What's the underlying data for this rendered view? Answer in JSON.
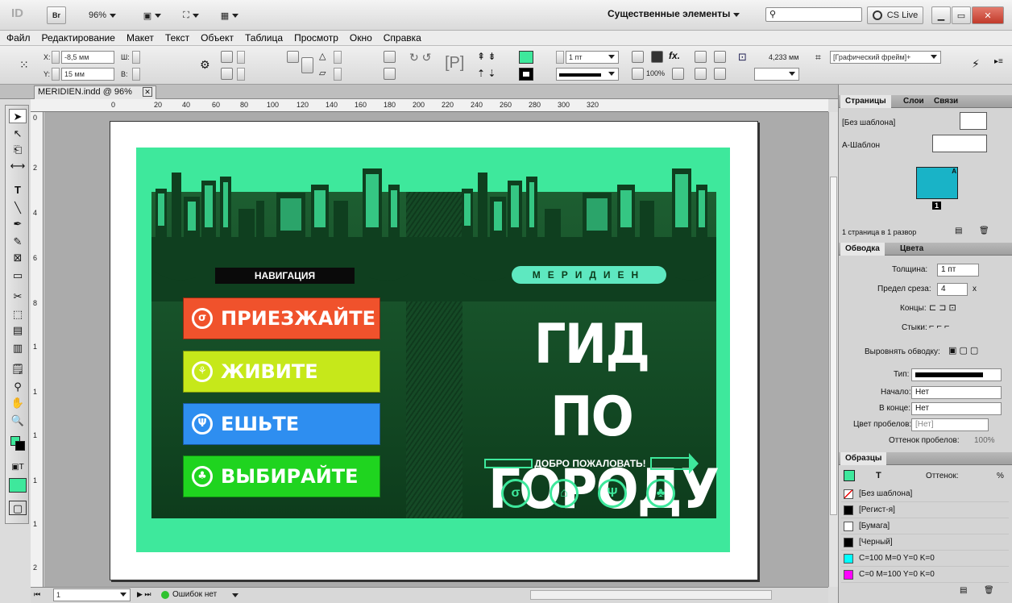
{
  "titlebar": {
    "zoom": "96%",
    "workspace": "Существенные элементы",
    "cslive": "CS Live",
    "app_glyph": "ID",
    "bridge": "Br"
  },
  "menu": [
    "Файл",
    "Редактирование",
    "Макет",
    "Текст",
    "Объект",
    "Таблица",
    "Просмотр",
    "Окно",
    "Справка"
  ],
  "control": {
    "x_label": "X:",
    "x_value": "-8,5 мм",
    "y_label": "Y:",
    "y_value": "15 мм",
    "w_label": "Ш:",
    "h_label": "В:",
    "stroke_weight": "1 пт",
    "zoom_pct": "100%",
    "dim_value": "4,233 мм",
    "frame_style": "[Графический фрейм]+"
  },
  "document": {
    "tab_title": "MERIDIEN.indd @ 96%",
    "ruler_h": [
      "0",
      "20",
      "40",
      "60",
      "80",
      "100",
      "120",
      "140",
      "160",
      "180",
      "200",
      "220",
      "240",
      "260",
      "280",
      "300",
      "320"
    ],
    "ruler_v": [
      "0",
      "2",
      "4",
      "6",
      "8",
      "1",
      "1",
      "1",
      "1",
      "1",
      "2",
      "2"
    ]
  },
  "poster": {
    "nav_label": "НАВИГАЦИЯ",
    "nav_items": [
      {
        "label": "ПРИЕЗЖАЙТЕ",
        "color": "#f0522c",
        "icon": "σ"
      },
      {
        "label": "ЖИВИТЕ",
        "color": "#c6e81a",
        "icon": "⚘"
      },
      {
        "label": "ЕШЬТЕ",
        "color": "#2e8ef0",
        "icon": "Ψ"
      },
      {
        "label": "ВЫБИРАЙТЕ",
        "color": "#1fd41f",
        "icon": "♣"
      }
    ],
    "brand": "МЕРИДИЕН",
    "title_line1": "ГИД ПО",
    "title_line2": "ГОРОДУ",
    "welcome": "ДОБРО ПОЖАЛОВАТЬ!",
    "bottom_icons": [
      "σ",
      "⌂",
      "Ψ",
      "♣"
    ]
  },
  "panels": {
    "pages": {
      "tabs": [
        "Страницы",
        "Слои",
        "Связи"
      ],
      "none_master": "[Без шаблона]",
      "a_master": "A-Шаблон",
      "page_number": "1",
      "page_letter": "A",
      "footer": "1 страница в 1 развор"
    },
    "stroke": {
      "tabs": [
        "Обводка",
        "Цвета"
      ],
      "weight_label": "Толщина:",
      "weight_value": "1 пт",
      "miter_label": "Предел среза:",
      "miter_value": "4",
      "miter_unit": "x",
      "caps_label": "Концы:",
      "joins_label": "Стыки:",
      "align_label": "Выровнять обводку:",
      "type_label": "Тип:",
      "start_label": "Начало:",
      "start_value": "Нет",
      "end_label": "В конце:",
      "end_value": "Нет",
      "gap_label": "Цвет пробелов:",
      "gap_value": "[Нет]",
      "gaptint_label": "Оттенок пробелов:",
      "gaptint_value": "100%"
    },
    "swatches": {
      "tab": "Образцы",
      "tint_label": "Оттенок:",
      "tint_unit": "%",
      "text_glyph": "T",
      "items": [
        {
          "name": "[Без шаблона]",
          "color": "none"
        },
        {
          "name": "[Регист-я]",
          "color": "#000000"
        },
        {
          "name": "[Бумага]",
          "color": "#ffffff"
        },
        {
          "name": "[Черный]",
          "color": "#000000"
        },
        {
          "name": "C=100 M=0 Y=0 K=0",
          "color": "#00ffff"
        },
        {
          "name": "C=0 M=100 Y=0 K=0",
          "color": "#ff00ff"
        }
      ]
    }
  },
  "status": {
    "page": "1",
    "errors": "Ошибок нет"
  }
}
